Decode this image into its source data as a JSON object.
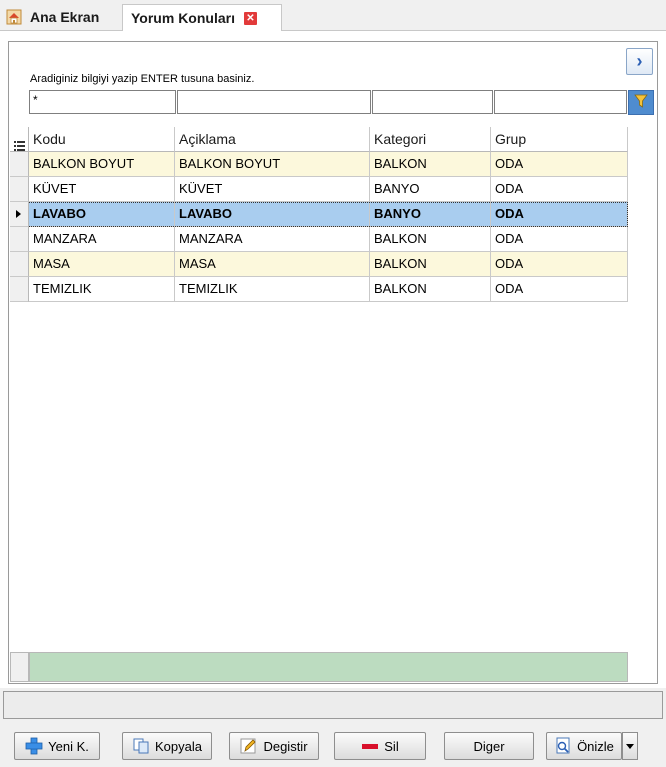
{
  "tabs": [
    {
      "label": "Ana Ekran",
      "icon": "home-icon"
    },
    {
      "label": "Yorum Konuları",
      "icon": "close-icon",
      "active": true
    }
  ],
  "search": {
    "hint": "Aradiginiz bilgiyi yazip ENTER tusuna basiniz.",
    "filter_values": [
      "*",
      "",
      "",
      ""
    ],
    "nav_button": "›"
  },
  "grid": {
    "columns": [
      "Kodu",
      "Açiklama",
      "Kategori",
      "Grup"
    ],
    "rows": [
      {
        "kodu": "BALKON BOYUT",
        "aciklama": "BALKON BOYUT",
        "kategori": "BALKON",
        "grup": "ODA"
      },
      {
        "kodu": "KÜVET",
        "aciklama": "KÜVET",
        "kategori": "BANYO",
        "grup": "ODA"
      },
      {
        "kodu": "LAVABO",
        "aciklama": "LAVABO",
        "kategori": "BANYO",
        "grup": "ODA",
        "selected": true
      },
      {
        "kodu": "MANZARA",
        "aciklama": "MANZARA",
        "kategori": "BALKON",
        "grup": "ODA"
      },
      {
        "kodu": "MASA",
        "aciklama": "MASA",
        "kategori": "BALKON",
        "grup": "ODA"
      },
      {
        "kodu": "TEMIZLIK",
        "aciklama": "TEMIZLIK",
        "kategori": "BALKON",
        "grup": "ODA"
      }
    ]
  },
  "buttons": {
    "new": "Yeni K.",
    "copy": "Kopyala",
    "edit": "Degistir",
    "delete": "Sil",
    "other": "Diger",
    "preview": "Önizle"
  },
  "colors": {
    "row_alt": "#fcf8dc",
    "row_selected": "#a9cdef",
    "footer": "#bcdcc0",
    "accent": "#2b5fb4"
  }
}
